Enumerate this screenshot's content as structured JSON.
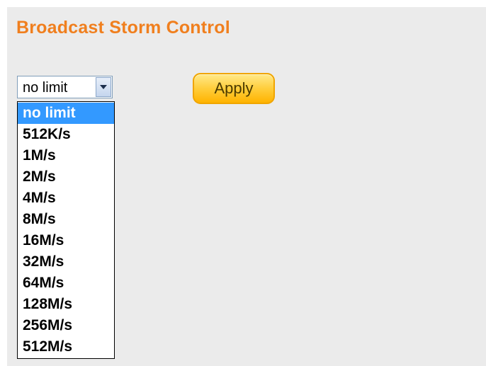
{
  "page": {
    "title": "Broadcast Storm Control"
  },
  "rate_select": {
    "value": "no limit",
    "options": [
      "no limit",
      "512K/s",
      "1M/s",
      "2M/s",
      "4M/s",
      "8M/s",
      "16M/s",
      "32M/s",
      "64M/s",
      "128M/s",
      "256M/s",
      "512M/s"
    ],
    "highlighted_option": "no limit",
    "expanded": true
  },
  "actions": {
    "apply_label": "Apply"
  },
  "colors": {
    "title": "#f07f1e",
    "panel_background": "#ebebeb",
    "highlight": "#3399ff",
    "button": "#ffcf3f"
  }
}
